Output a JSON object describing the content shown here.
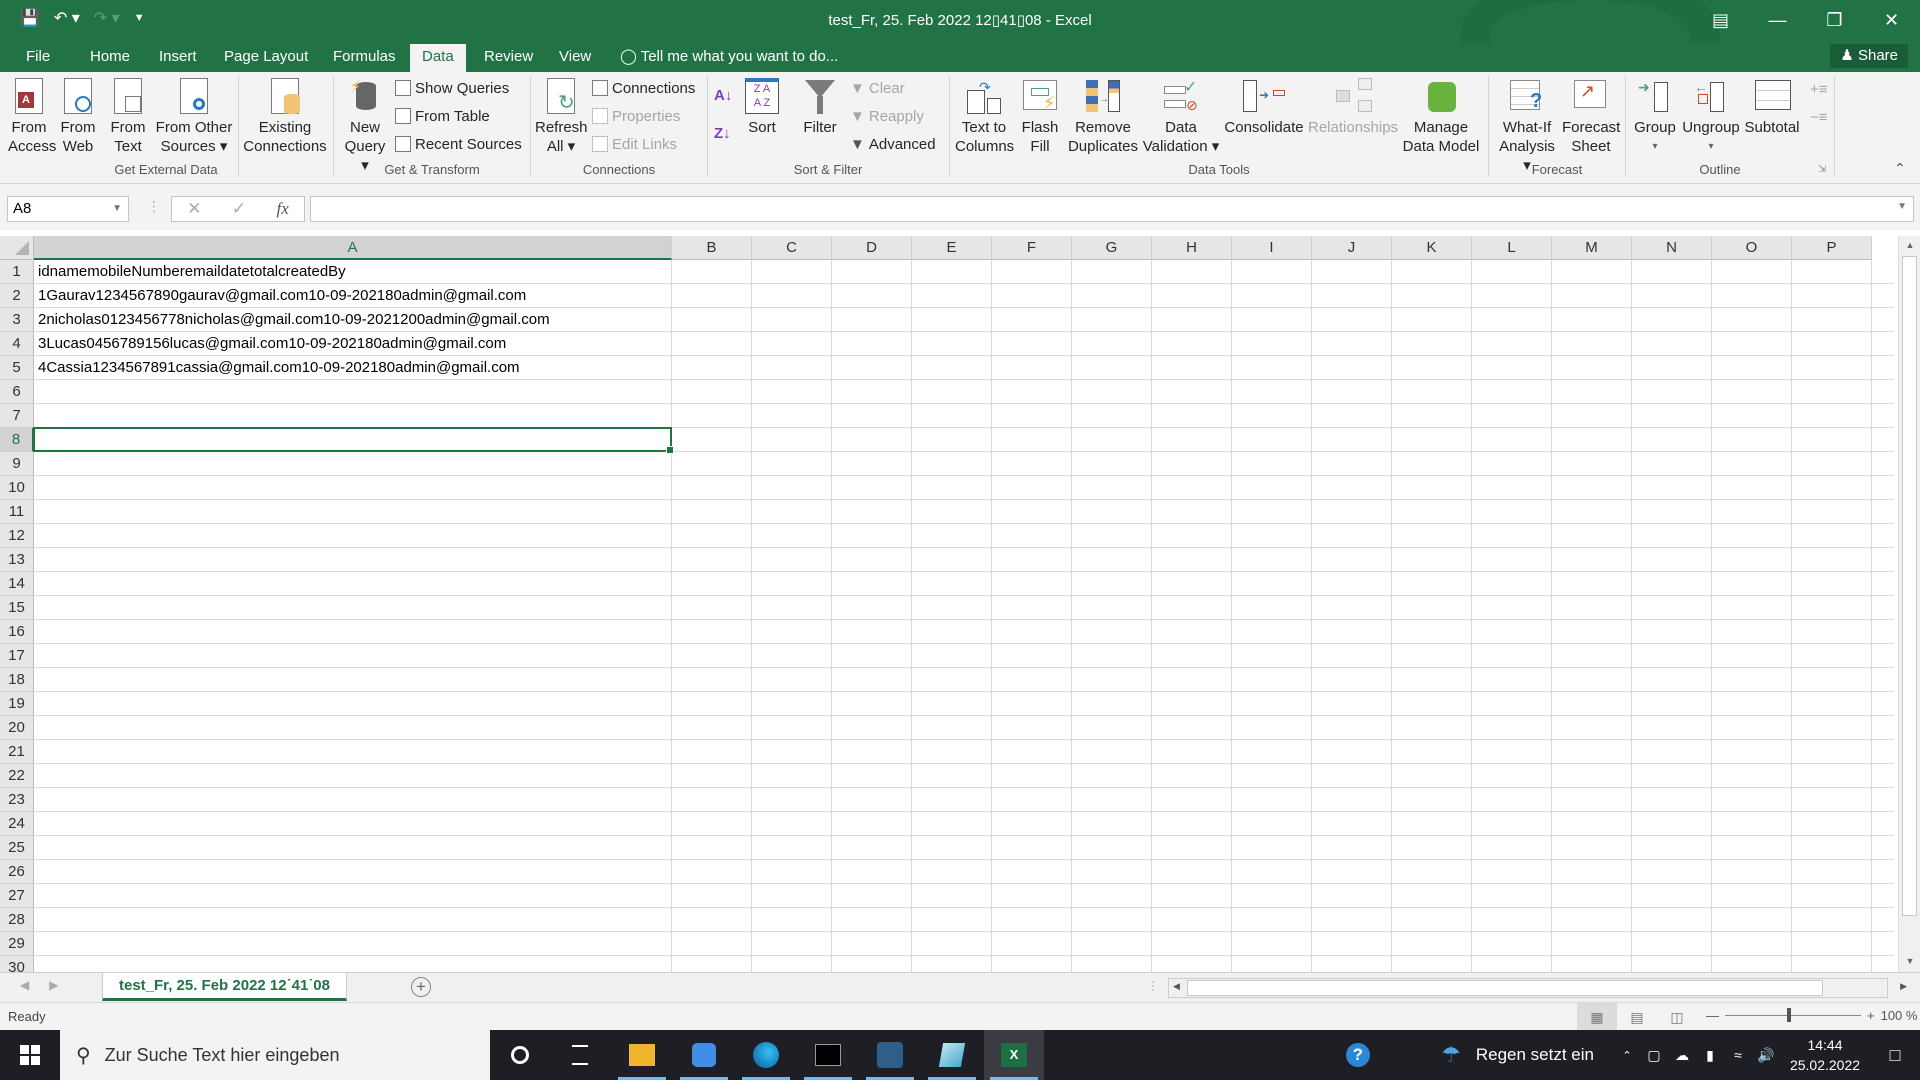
{
  "window": {
    "title": "test_Fr, 25. Feb 2022 12▯41▯08 - Excel",
    "controls": [
      "ribbon-display-icon",
      "minimize-icon",
      "restore-icon",
      "close-icon"
    ]
  },
  "qat": {
    "save": "save-icon",
    "undo": "undo-icon",
    "redo": "redo-icon",
    "customize": "customize-icon"
  },
  "tabs": [
    {
      "label": "File"
    },
    {
      "label": "Home"
    },
    {
      "label": "Insert"
    },
    {
      "label": "Page Layout"
    },
    {
      "label": "Formulas"
    },
    {
      "label": "Data",
      "active": true
    },
    {
      "label": "Review"
    },
    {
      "label": "View"
    }
  ],
  "tellme": "Tell me what you want to do...",
  "share": "Share",
  "ribbon": {
    "get_external": {
      "from_access": [
        "From",
        "Access"
      ],
      "from_web": [
        "From",
        "Web"
      ],
      "from_text": [
        "From",
        "Text"
      ],
      "from_other": [
        "From Other",
        "Sources ▾"
      ],
      "existing": [
        "Existing",
        "Connections"
      ],
      "group": "Get External Data"
    },
    "get_transform": {
      "new_query": [
        "New",
        "Query ▾"
      ],
      "show_queries": "Show Queries",
      "from_table": "From Table",
      "recent_sources": "Recent Sources",
      "group": "Get & Transform"
    },
    "connections": {
      "refresh": [
        "Refresh",
        "All ▾"
      ],
      "connections": "Connections",
      "properties": "Properties",
      "edit_links": "Edit Links",
      "group": "Connections"
    },
    "sort_filter": {
      "sort": "Sort",
      "filter": "Filter",
      "clear": "Clear",
      "reapply": "Reapply",
      "advanced": "Advanced",
      "group": "Sort & Filter"
    },
    "data_tools": {
      "text_to_columns": [
        "Text to",
        "Columns"
      ],
      "flash_fill": [
        "Flash",
        "Fill"
      ],
      "remove_duplicates": [
        "Remove",
        "Duplicates"
      ],
      "data_validation": [
        "Data",
        "Validation ▾"
      ],
      "consolidate": "Consolidate",
      "relationships": "Relationships",
      "manage_data_model": [
        "Manage",
        "Data Model"
      ],
      "group": "Data Tools"
    },
    "forecast": {
      "what_if": [
        "What-If",
        "Analysis ▾"
      ],
      "forecast_sheet": [
        "Forecast",
        "Sheet"
      ],
      "group": "Forecast"
    },
    "outline": {
      "group_btn": [
        "Group",
        "▾"
      ],
      "ungroup": [
        "Ungroup",
        "▾"
      ],
      "subtotal": "Subtotal",
      "group": "Outline"
    }
  },
  "formula_bar": {
    "name_box": "A8",
    "formula": "",
    "fx": "fx"
  },
  "columns": [
    "A",
    "B",
    "C",
    "D",
    "E",
    "F",
    "G",
    "H",
    "I",
    "J",
    "K",
    "L",
    "M",
    "N",
    "O",
    "P"
  ],
  "rows": [
    "1",
    "2",
    "3",
    "4",
    "5",
    "6",
    "7",
    "8",
    "9",
    "10",
    "11",
    "12",
    "13",
    "14",
    "15",
    "16",
    "17",
    "18",
    "19",
    "20",
    "21",
    "22",
    "23",
    "24",
    "25",
    "26",
    "27",
    "28",
    "29",
    "30"
  ],
  "cells": {
    "A1": "idnamemobileNumberemaildatetotalcreatedBy",
    "A2": "1Gaurav1234567890gaurav@gmail.com10-09-202180admin@gmail.com",
    "A3": "2nicholas0123456778nicholas@gmail.com10-09-2021200admin@gmail.com",
    "A4": "3Lucas0456789156lucas@gmail.com10-09-202180admin@gmail.com",
    "A5": "4Cassia1234567891cassia@gmail.com10-09-202180admin@gmail.com"
  },
  "selected_cell": "A8",
  "sheet_tab": "test_Fr, 25. Feb 2022 12˙41˙08",
  "status": {
    "ready": "Ready",
    "zoom": "100 %"
  },
  "taskbar": {
    "search_placeholder": "Zur Suche Text hier eingeben",
    "weather": "Regen setzt ein",
    "time": "14:44",
    "date": "25.02.2022"
  }
}
